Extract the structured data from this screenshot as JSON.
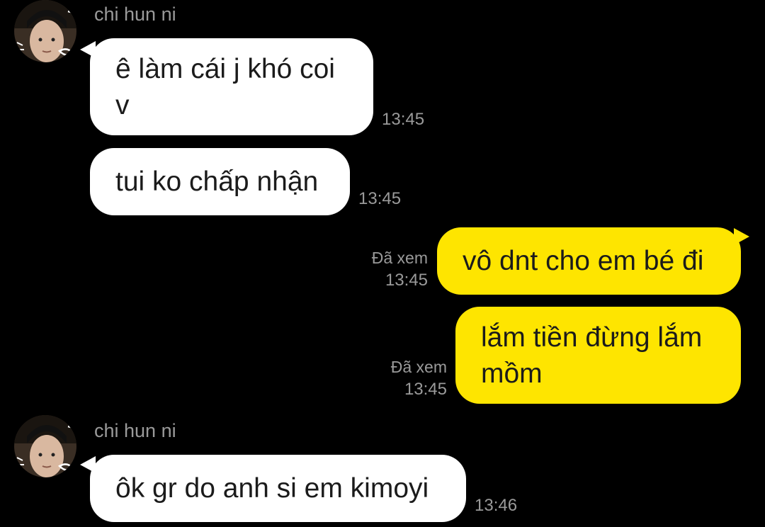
{
  "conversation": {
    "messages": [
      {
        "direction": "incoming",
        "sender": "chi hun ni",
        "lines": [
          "ê làm cái j khó coi",
          "v"
        ],
        "time": "13:45"
      },
      {
        "direction": "incoming",
        "lines": [
          "tui ko chấp nhận"
        ],
        "time": "13:45"
      },
      {
        "direction": "outgoing",
        "lines": [
          "vô dnt cho em bé đi"
        ],
        "read": "Đã xem",
        "time": "13:45"
      },
      {
        "direction": "outgoing",
        "lines": [
          "lắm tiền đừng lắm",
          "mồm"
        ],
        "read": "Đã xem",
        "time": "13:45"
      },
      {
        "direction": "incoming",
        "sender": "chi hun ni",
        "lines": [
          "ôk gr do anh si em kimoyi"
        ],
        "time": "13:46"
      }
    ]
  },
  "colors": {
    "background": "#000000",
    "incoming_bubble": "#ffffff",
    "outgoing_bubble": "#fee500",
    "meta_text": "#9a9a9a"
  },
  "icons": {
    "avatar": "profile-photo-avatar"
  }
}
